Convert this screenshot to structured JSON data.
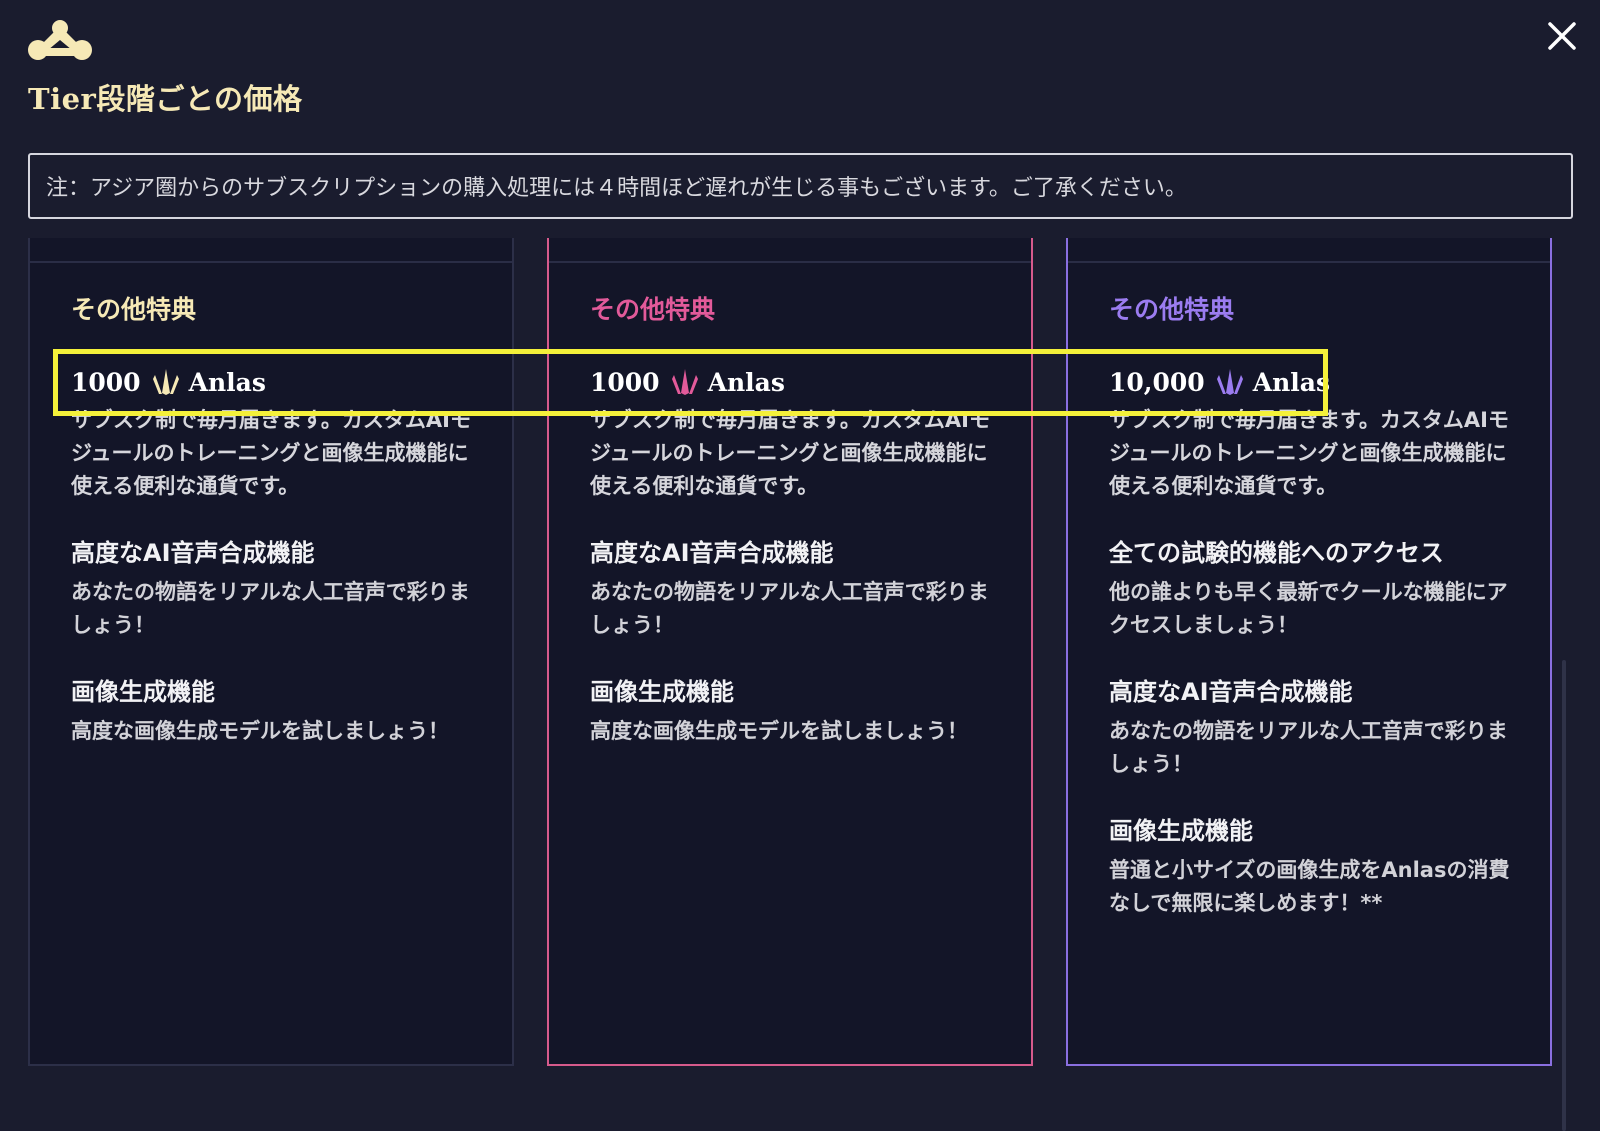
{
  "modal": {
    "title": "Tier段階ごとの価格",
    "notice": "注：アジア圏からのサブスクリプションの購入処理には４時間ほど遅れが生じる事もございます。ご了承ください。",
    "logo_icon": "novelai-logo-icon",
    "close_icon": "close-icon"
  },
  "colors": {
    "background": "#1a1c2e",
    "card_background": "#131528",
    "tier1_accent": "#f6e9b6",
    "tier2_accent": "#e25a9a",
    "tier3_accent": "#9b7cf0",
    "highlight": "#f4f03a"
  },
  "tiers": [
    {
      "perks_title": "その他特典",
      "anlas_amount": "1000",
      "anlas_label": "Anlas",
      "anlas_desc": "サブスク制で毎月届きます。カスタムAIモジュールのトレーニングと画像生成機能に使える便利な通貨です。",
      "features": [
        {
          "title": "高度なAI音声合成機能",
          "desc": "あなたの物語をリアルな人工音声で彩りましょう！"
        },
        {
          "title": "画像生成機能",
          "desc": "高度な画像生成モデルを試しましょう！"
        }
      ]
    },
    {
      "perks_title": "その他特典",
      "anlas_amount": "1000",
      "anlas_label": "Anlas",
      "anlas_desc": "サブスク制で毎月届きます。カスタムAIモジュールのトレーニングと画像生成機能に使える便利な通貨です。",
      "features": [
        {
          "title": "高度なAI音声合成機能",
          "desc": "あなたの物語をリアルな人工音声で彩りましょう！"
        },
        {
          "title": "画像生成機能",
          "desc": "高度な画像生成モデルを試しましょう！"
        }
      ]
    },
    {
      "perks_title": "その他特典",
      "anlas_amount": "10,000",
      "anlas_label": "Anlas",
      "anlas_desc": "サブスク制で毎月届きます。カスタムAIモジュールのトレーニングと画像生成機能に使える便利な通貨です。",
      "features": [
        {
          "title": "全ての試験的機能へのアクセス",
          "desc": "他の誰よりも早く最新でクールな機能にアクセスしましょう！"
        },
        {
          "title": "高度なAI音声合成機能",
          "desc": "あなたの物語をリアルな人工音声で彩りましょう！"
        },
        {
          "title": "画像生成機能",
          "desc": "普通と小サイズの画像生成をAnlasの消費なしで無限に楽しめます！**"
        }
      ]
    }
  ]
}
